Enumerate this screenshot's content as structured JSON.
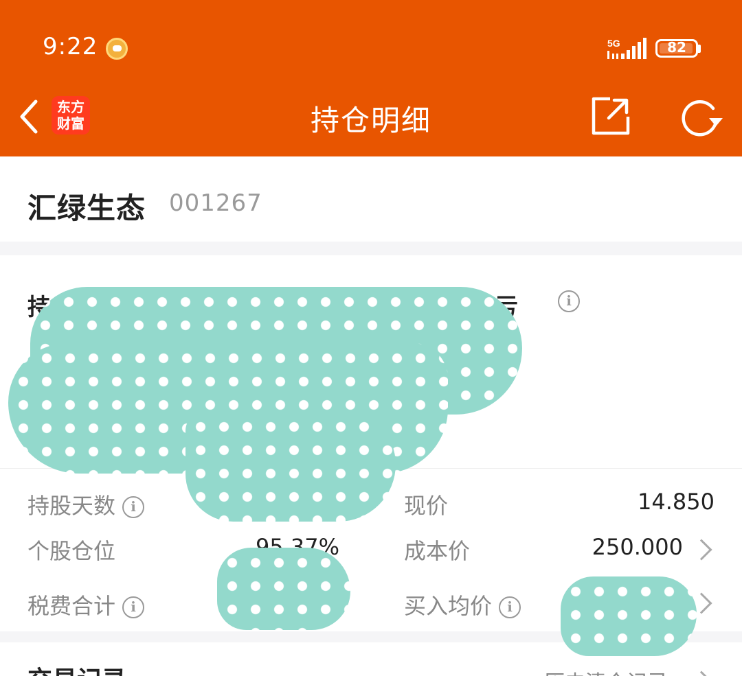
{
  "status_bar": {
    "time": "9:22",
    "network": "5G",
    "battery": "82"
  },
  "nav": {
    "title": "持仓明细",
    "logo_line1": "东方",
    "logo_line2": "财富"
  },
  "stock": {
    "name": "汇绿生态",
    "code": "001267"
  },
  "position": {
    "left_label": "持仓",
    "right_label": "盈亏",
    "hold_days_label": "持股天数",
    "position_ratio_label": "个股仓位",
    "position_ratio_value": "95.37%",
    "fee_total_label": "税费合计",
    "current_price_label": "现价",
    "current_price_value": "14.850",
    "cost_price_label": "成本价",
    "cost_price_value": "250.000",
    "avg_buy_price_label": "买入均价"
  },
  "trade": {
    "title": "交易记录",
    "history_link": "历史清仓记录"
  },
  "colors": {
    "header": "#e85500",
    "privacy_mask": "#93d9cc"
  },
  "icons": {
    "back": "chevron-left-icon",
    "share": "share-icon",
    "refresh": "refresh-icon",
    "info": "info-icon"
  }
}
